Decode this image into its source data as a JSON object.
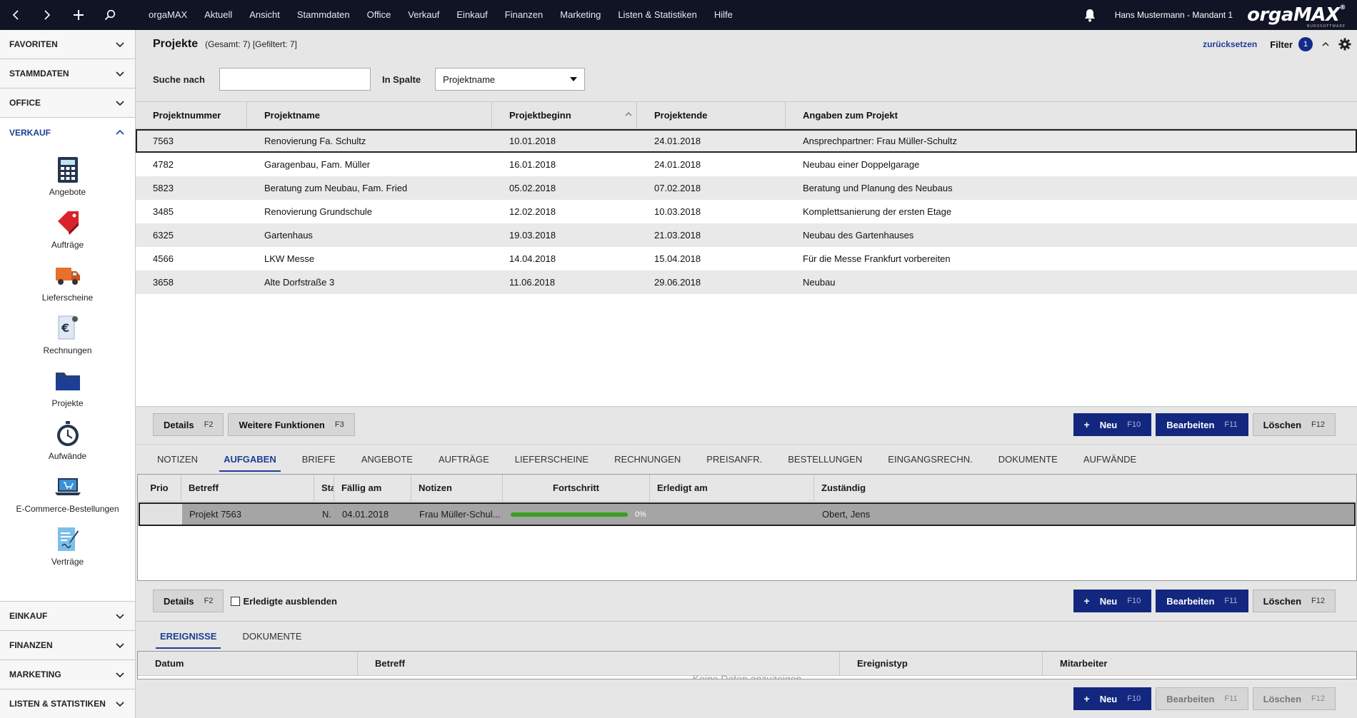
{
  "topbar": {
    "menu": [
      "orgaMAX",
      "Aktuell",
      "Ansicht",
      "Stammdaten",
      "Office",
      "Verkauf",
      "Einkauf",
      "Finanzen",
      "Marketing",
      "Listen & Statistiken",
      "Hilfe"
    ],
    "user": "Hans Mustermann - Mandant 1",
    "logo": "orgaMAX",
    "logo_sub": "BUROSOFTWARE"
  },
  "sidebar": {
    "sections_top": [
      "FAVORITEN",
      "STAMMDATEN",
      "OFFICE"
    ],
    "active_section": "VERKAUF",
    "items": [
      {
        "label": "Angebote",
        "icon": "calculator-icon"
      },
      {
        "label": "Aufträge",
        "icon": "tag-icon"
      },
      {
        "label": "Lieferscheine",
        "icon": "truck-icon"
      },
      {
        "label": "Rechnungen",
        "icon": "invoice-icon"
      },
      {
        "label": "Projekte",
        "icon": "folder-icon"
      },
      {
        "label": "Aufwände",
        "icon": "stopwatch-icon"
      },
      {
        "label": "E-Commerce-Bestellungen",
        "icon": "laptop-cart-icon"
      },
      {
        "label": "Verträge",
        "icon": "contract-icon"
      }
    ],
    "sections_bottom": [
      "EINKAUF",
      "FINANZEN",
      "MARKETING",
      "LISTEN & STATISTIKEN"
    ]
  },
  "header": {
    "title": "Projekte",
    "counts": "(Gesamt: 7) [Gefiltert: 7]",
    "reset": "zurücksetzen",
    "filter": "Filter",
    "filter_count": "1"
  },
  "search": {
    "label": "Suche nach",
    "value": "",
    "column_label": "In Spalte",
    "column_value": "Projektname"
  },
  "projects": {
    "columns": [
      "Projektnummer",
      "Projektname",
      "Projektbeginn",
      "Projektende",
      "Angaben zum Projekt"
    ],
    "rows": [
      [
        "7563",
        "Renovierung Fa. Schultz",
        "10.01.2018",
        "24.01.2018",
        "Ansprechpartner: Frau Müller-Schultz"
      ],
      [
        "4782",
        "Garagenbau, Fam. Müller",
        "16.01.2018",
        "24.01.2018",
        "Neubau einer Doppelgarage"
      ],
      [
        "5823",
        "Beratung zum Neubau, Fam. Fried",
        "05.02.2018",
        "07.02.2018",
        "Beratung und Planung des Neubaus"
      ],
      [
        "3485",
        "Renovierung Grundschule",
        "12.02.2018",
        "10.03.2018",
        "Komplettsanierung der ersten Etage"
      ],
      [
        "6325",
        "Gartenhaus",
        "19.03.2018",
        "21.03.2018",
        "Neubau des Gartenhauses"
      ],
      [
        "4566",
        "LKW Messe",
        "14.04.2018",
        "15.04.2018",
        "Für die Messe Frankfurt vorbereiten"
      ],
      [
        "3658",
        "Alte Dorfstraße 3",
        "11.06.2018",
        "29.06.2018",
        "Neubau"
      ]
    ]
  },
  "bar1": {
    "details": "Details",
    "details_key": "F2",
    "more": "Weitere Funktionen",
    "more_key": "F3",
    "new": "Neu",
    "new_key": "F10",
    "edit": "Bearbeiten",
    "edit_key": "F11",
    "delete": "Löschen",
    "delete_key": "F12"
  },
  "tabs1": [
    "NOTIZEN",
    "AUFGABEN",
    "BRIEFE",
    "ANGEBOTE",
    "AUFTRÄGE",
    "LIEFERSCHEINE",
    "RECHNUNGEN",
    "PREISANFR.",
    "BESTELLUNGEN",
    "EINGANGSRECHN.",
    "DOKUMENTE",
    "AUFWÄNDE"
  ],
  "tasks": {
    "columns": [
      "Prio",
      "Betreff",
      "Stat",
      "Fällig am",
      "Notizen",
      "Fortschritt",
      "Erledigt am",
      "Zuständig"
    ],
    "row": {
      "prio": "",
      "betreff": "Projekt 7563",
      "status": "N.",
      "faellig": "04.01.2018",
      "notizen": "Frau Müller-Schul...",
      "progress": "0%",
      "erledigt": "",
      "zustaendig": "Obert, Jens"
    }
  },
  "bar2": {
    "details": "Details",
    "details_key": "F2",
    "hide_done": "Erledigte ausblenden",
    "new": "Neu",
    "new_key": "F10",
    "edit": "Bearbeiten",
    "edit_key": "F11",
    "delete": "Löschen",
    "delete_key": "F12"
  },
  "tabs2": [
    "EREIGNISSE",
    "DOKUMENTE"
  ],
  "events": {
    "columns": [
      "Datum",
      "Betreff",
      "Ereignistyp",
      "Mitarbeiter"
    ],
    "empty": "Keine Daten anzuzeigen"
  },
  "bar3": {
    "new": "Neu",
    "new_key": "F10",
    "edit": "Bearbeiten",
    "edit_key": "F11",
    "delete": "Löschen",
    "delete_key": "F12"
  }
}
